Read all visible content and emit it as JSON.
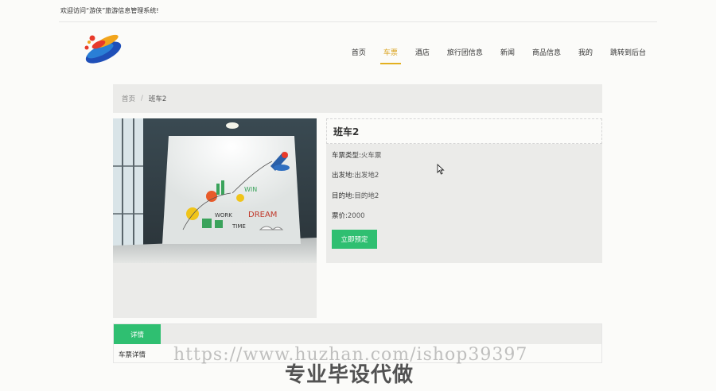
{
  "header": {
    "welcome": "欢迎访问“游侠”旅游信息管理系统!"
  },
  "nav": {
    "items": [
      {
        "label": "首页",
        "active": false
      },
      {
        "label": "车票",
        "active": true
      },
      {
        "label": "酒店",
        "active": false
      },
      {
        "label": "旅行团信息",
        "active": false
      },
      {
        "label": "新闻",
        "active": false
      },
      {
        "label": "商品信息",
        "active": false
      },
      {
        "label": "我的",
        "active": false
      },
      {
        "label": "跳转到后台",
        "active": false
      }
    ]
  },
  "breadcrumb": {
    "home": "首页",
    "separator": "/",
    "current": "班车2"
  },
  "detail": {
    "title": "班车2",
    "fields": [
      {
        "label": "车票类型:",
        "value": "火车票"
      },
      {
        "label": "出发地:",
        "value": "出发地2"
      },
      {
        "label": "目的地:",
        "value": "目的地2"
      },
      {
        "label": "票价:",
        "value": "2000"
      }
    ],
    "book_button": "立即预定"
  },
  "tabs": {
    "items": [
      {
        "label": "详情"
      }
    ],
    "content": "车票详情"
  },
  "watermark": {
    "url": "https://www.huzhan.com/ishop39397",
    "caption": "专业毕设代做"
  },
  "colors": {
    "accent": "#2fbf71",
    "nav_active": "#d9a21c",
    "panel_bg": "#ebebe9"
  }
}
